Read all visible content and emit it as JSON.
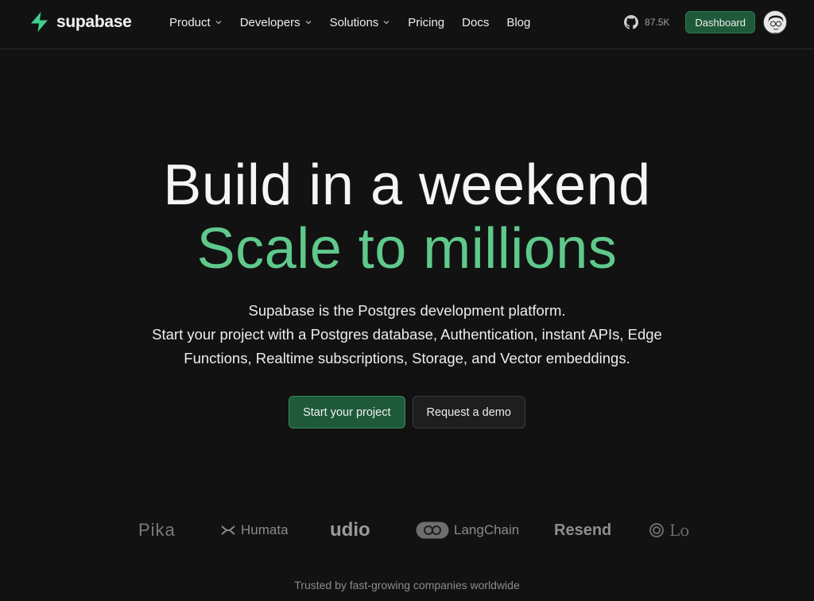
{
  "nav": {
    "brand": "supabase",
    "links": [
      {
        "label": "Product",
        "dropdown": true
      },
      {
        "label": "Developers",
        "dropdown": true
      },
      {
        "label": "Solutions",
        "dropdown": true
      },
      {
        "label": "Pricing",
        "dropdown": false
      },
      {
        "label": "Docs",
        "dropdown": false
      },
      {
        "label": "Blog",
        "dropdown": false
      }
    ],
    "github_stars": "87.5K",
    "dashboard_label": "Dashboard"
  },
  "hero": {
    "title_line1": "Build in a weekend",
    "title_line2": "Scale to millions",
    "subtitle_line1": "Supabase is the Postgres development platform.",
    "subtitle_line2": "Start your project with a Postgres database, Authentication, instant APIs, Edge",
    "subtitle_line3": "Functions, Realtime subscriptions, Storage, and Vector embeddings.",
    "primary_cta": "Start your project",
    "secondary_cta": "Request a demo"
  },
  "customers": {
    "logos": [
      "Pika",
      "Humata",
      "udio",
      "LangChain",
      "Resend",
      "Lo"
    ],
    "trusted_text": "Trusted by fast-growing companies worldwide"
  },
  "colors": {
    "background": "#121212",
    "brand_green": "#3ecf8e",
    "accent_text": "#5fc98c",
    "button_green": "#1e5a3a"
  },
  "icons": {
    "brand": "supabase-bolt-icon",
    "github": "github-icon",
    "dropdown": "chevron-down-icon"
  }
}
